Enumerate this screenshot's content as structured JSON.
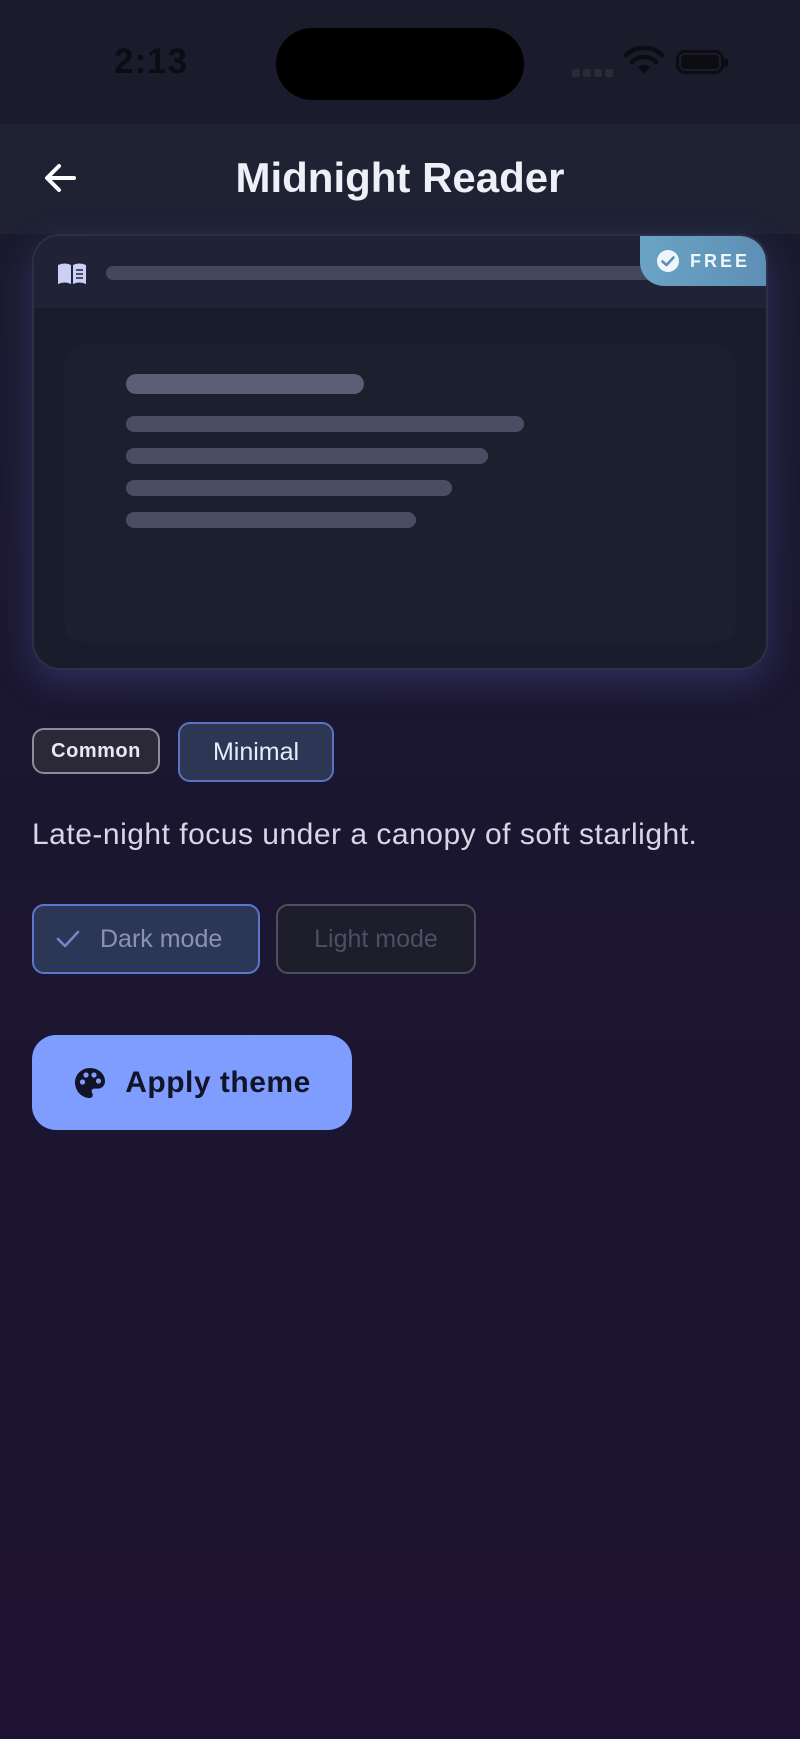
{
  "status_bar": {
    "time": "2:13"
  },
  "header": {
    "title": "Midnight Reader"
  },
  "preview": {
    "badge_label": "FREE"
  },
  "tags": [
    "Common",
    "Minimal"
  ],
  "description": "Late-night focus under a canopy of soft starlight.",
  "modes": {
    "dark_label": "Dark mode",
    "light_label": "Light mode",
    "selected": "dark"
  },
  "actions": {
    "apply_label": "Apply theme"
  },
  "colors": {
    "accent": "#7f9cff",
    "badge": "#6aa4c4",
    "background": "#1b1730"
  },
  "icons": [
    "back-arrow-icon",
    "book-icon",
    "check-circle-icon",
    "check-icon",
    "palette-icon",
    "wifi-icon",
    "battery-icon"
  ]
}
